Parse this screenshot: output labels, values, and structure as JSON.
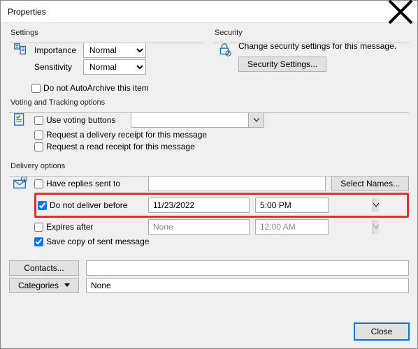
{
  "window": {
    "title": "Properties"
  },
  "settings": {
    "legend": "Settings",
    "importance_label": "Importance",
    "importance_value": "Normal",
    "sensitivity_label": "Sensitivity",
    "sensitivity_value": "Normal",
    "autoarchive_label": "Do not AutoArchive this item"
  },
  "security": {
    "legend": "Security",
    "description": "Change security settings for this message.",
    "button": "Security Settings..."
  },
  "voting": {
    "legend": "Voting and Tracking options",
    "use_voting_label": "Use voting buttons",
    "voting_value": "",
    "delivery_receipt_label": "Request a delivery receipt for this message",
    "read_receipt_label": "Request a read receipt for this message"
  },
  "delivery": {
    "legend": "Delivery options",
    "replies_label": "Have replies sent to",
    "replies_value": "",
    "select_names": "Select Names...",
    "no_deliver_label": "Do not deliver before",
    "no_deliver_date": "11/23/2022",
    "no_deliver_time": "5:00 PM",
    "expires_label": "Expires after",
    "expires_date": "None",
    "expires_time": "12:00 AM",
    "save_copy_label": "Save copy of sent message"
  },
  "bottom": {
    "contacts_button": "Contacts...",
    "contacts_value": "",
    "categories_button": "Categories",
    "categories_value": "None"
  },
  "footer": {
    "close": "Close"
  }
}
